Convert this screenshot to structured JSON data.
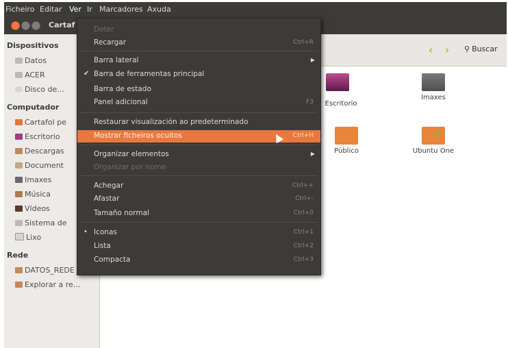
{
  "menubar": {
    "items": [
      "Ficheiro",
      "Editar",
      "Ver",
      "Ir",
      "Marcadores",
      "Axuda"
    ]
  },
  "window": {
    "title": "Cartaf"
  },
  "toolbar": {
    "search_label": "Buscar"
  },
  "sidebar": {
    "sections": [
      {
        "title": "Dispositivos",
        "items": [
          "Datos",
          "ACER",
          "Disco de..."
        ]
      },
      {
        "title": "Computador",
        "items": [
          "Cartafol pe",
          "Escritorio",
          "Descargas",
          "Document",
          "Imaxes",
          "Música",
          "Vídeos",
          "Sistema de",
          "Lixo"
        ]
      },
      {
        "title": "Rede",
        "items": [
          "DATOS_REDE",
          "Explorar a re..."
        ]
      }
    ]
  },
  "content": {
    "tiles": [
      "Escritorio",
      "Imaxes",
      "Público",
      "Ubuntu One"
    ]
  },
  "view_menu": {
    "items": [
      {
        "label": "Deter",
        "accel": "",
        "state": "disabled"
      },
      {
        "label": "Recargar",
        "accel": "Ctrl+R",
        "state": "normal"
      },
      {
        "label": "Barra lateral",
        "accel": "",
        "state": "submenu"
      },
      {
        "label": "Barra de ferramentas principal",
        "accel": "",
        "state": "checked"
      },
      {
        "label": "Barra de estado",
        "accel": "",
        "state": "normal"
      },
      {
        "label": "Panel adicional",
        "accel": "F3",
        "state": "normal"
      },
      {
        "label": "Restaurar visualización ao predeterminado",
        "accel": "",
        "state": "normal"
      },
      {
        "label": "Mostrar ficheiros ocultos",
        "accel": "Ctrl+H",
        "state": "highlighted"
      },
      {
        "label": "Organizar elementos",
        "accel": "",
        "state": "submenu"
      },
      {
        "label": "Organizar por nome",
        "accel": "",
        "state": "disabled"
      },
      {
        "label": "Achegar",
        "accel": "Ctrl++",
        "state": "normal"
      },
      {
        "label": "Afastar",
        "accel": "Ctrl+-",
        "state": "normal"
      },
      {
        "label": "Tamaño normal",
        "accel": "Ctrl+0",
        "state": "normal"
      },
      {
        "label": "Iconas",
        "accel": "Ctrl+1",
        "state": "radio-selected"
      },
      {
        "label": "Lista",
        "accel": "Ctrl+2",
        "state": "normal"
      },
      {
        "label": "Compacta",
        "accel": "Ctrl+3",
        "state": "normal"
      }
    ]
  },
  "colors": {
    "accent": "#e9783f",
    "menu_bg": "#3c3b37"
  }
}
